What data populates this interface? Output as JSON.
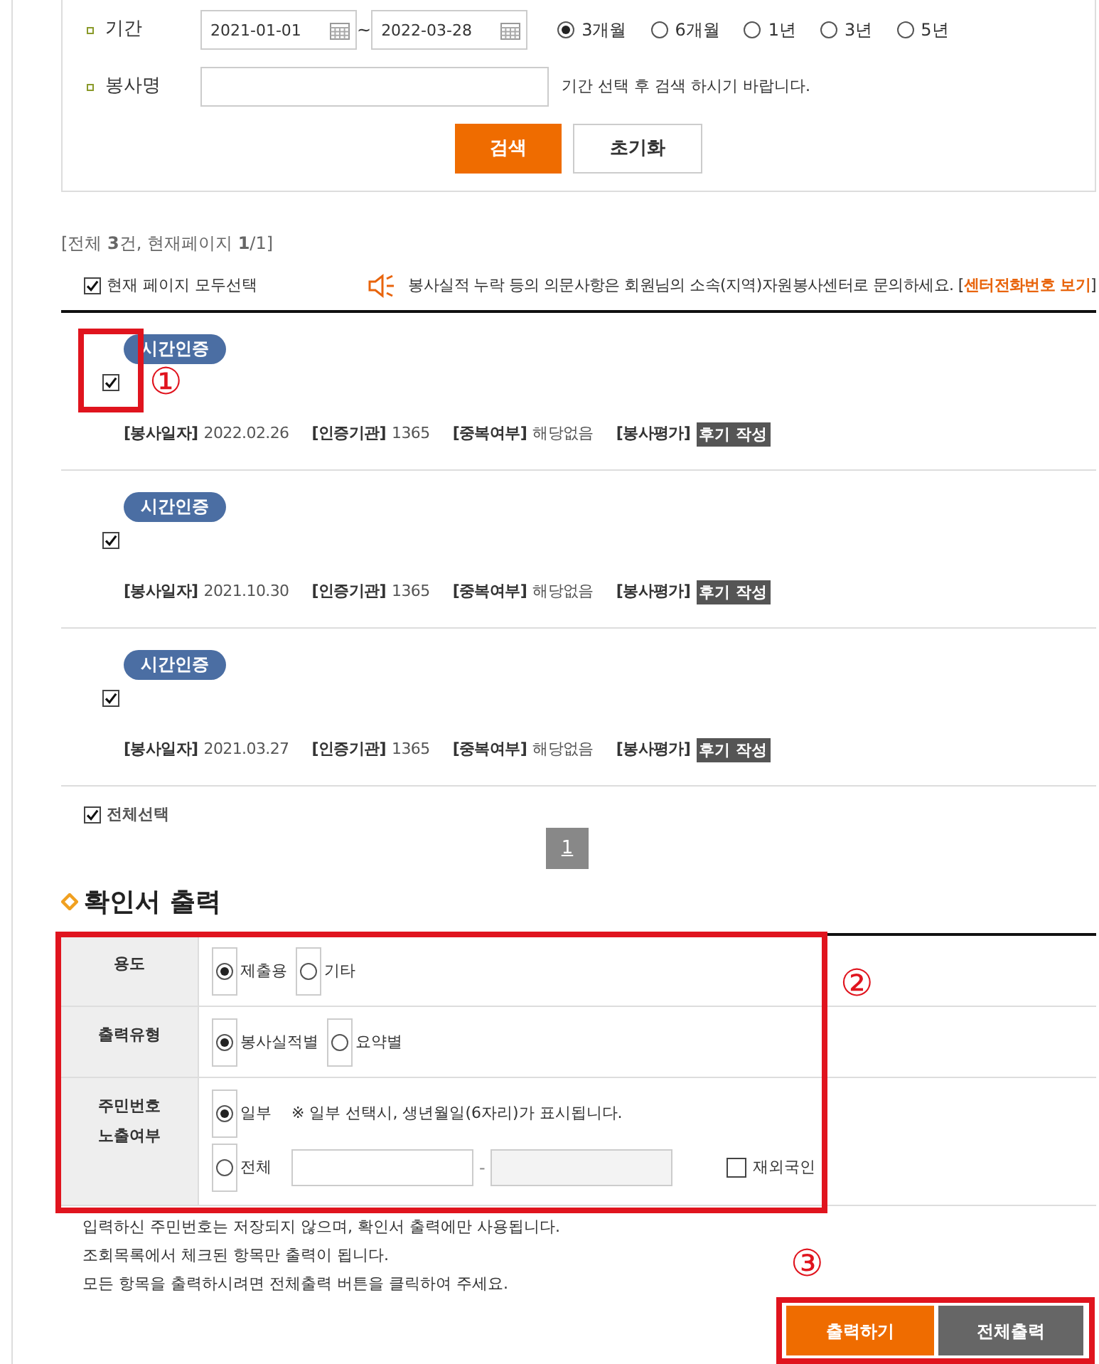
{
  "search": {
    "period_label": "기간",
    "start_date": "2021-01-01",
    "separator": "~",
    "end_date": "2022-03-28",
    "ranges": [
      {
        "label": "3개월",
        "selected": true
      },
      {
        "label": "6개월",
        "selected": false
      },
      {
        "label": "1년",
        "selected": false
      },
      {
        "label": "3년",
        "selected": false
      },
      {
        "label": "5년",
        "selected": false
      }
    ],
    "name_label": "봉사명",
    "name_hint": "기간 선택 후 검색 하시기 바랍니다.",
    "buttons": [
      {
        "label": "검색",
        "kind": "primary"
      },
      {
        "label": "초기화",
        "kind": "secondary"
      }
    ]
  },
  "summary": "[전체 **3**건, 현재페이지 **1**/1]",
  "select_page": {
    "label": "현재 페이지 모두선택",
    "checked": true
  },
  "notice": {
    "text": "봉사실적 누락 등의 의문사항은 회원님의 소속(지역)자원봉사센터로 문의하세요. [",
    "link": "센터전화번호 보기",
    "suffix": "]"
  },
  "records": [
    {
      "badge": "시간인증",
      "checked": true,
      "highlighted": true,
      "annotation": "①",
      "fields": [
        {
          "label": "[봉사일자]",
          "value": "2022.02.26"
        },
        {
          "label": "[인증기관]",
          "value": "1365"
        },
        {
          "label": "[중복여부]",
          "value": "해당없음"
        },
        {
          "label": "[봉사평가]",
          "value": "후기 작성"
        }
      ]
    },
    {
      "badge": "시간인증",
      "checked": true,
      "highlighted": false,
      "fields": [
        {
          "label": "[봉사일자]",
          "value": "2021.10.30"
        },
        {
          "label": "[인증기관]",
          "value": "1365"
        },
        {
          "label": "[중복여부]",
          "value": "해당없음"
        },
        {
          "label": "[봉사평가]",
          "value": "후기 작성"
        }
      ]
    },
    {
      "badge": "시간인증",
      "checked": true,
      "highlighted": false,
      "fields": [
        {
          "label": "[봉사일자]",
          "value": "2021.03.27"
        },
        {
          "label": "[인증기관]",
          "value": "1365"
        },
        {
          "label": "[중복여부]",
          "value": "해당없음"
        },
        {
          "label": "[봉사평가]",
          "value": "후기 작성"
        }
      ]
    }
  ],
  "select_all": {
    "label": "전체선택",
    "checked": true
  },
  "pages": [
    {
      "label": "1",
      "selected": true
    }
  ],
  "certificate": {
    "title": "확인서 출력",
    "highlighted": true,
    "annotation": "②",
    "rows": [
      {
        "label": "용도",
        "kind": "radio",
        "options": [
          {
            "label": "제출용",
            "selected": true
          },
          {
            "label": "기타",
            "selected": false
          }
        ]
      },
      {
        "label": "출력유형",
        "kind": "radio",
        "options": [
          {
            "label": "봉사실적별",
            "selected": true
          },
          {
            "label": "요약별",
            "selected": false
          }
        ]
      },
      {
        "label": "주민번호 노출여부",
        "kind": "resident",
        "options": [
          {
            "label": "일부",
            "selected": true,
            "note": "※ 일부 선택시, 생년월일(6자리)가 표시됩니다."
          },
          {
            "label": "전체",
            "selected": false
          }
        ],
        "separator": "-",
        "foreigner": {
          "label": "재외국인",
          "checked": false
        }
      }
    ]
  },
  "notes": [
    "입력하신 주민번호는 저장되지 않으며, 확인서 출력에만 사용됩니다.",
    "조회목록에서 체크된 항목만 출력이 됩니다.",
    "모든 항목을 출력하시려면 전체출력 버튼을 클릭하여 주세요."
  ],
  "actions": {
    "highlighted": true,
    "annotation": "③",
    "buttons": [
      {
        "label": "출력하기",
        "kind": "primary"
      },
      {
        "label": "전체출력",
        "kind": "secondary"
      }
    ]
  }
}
